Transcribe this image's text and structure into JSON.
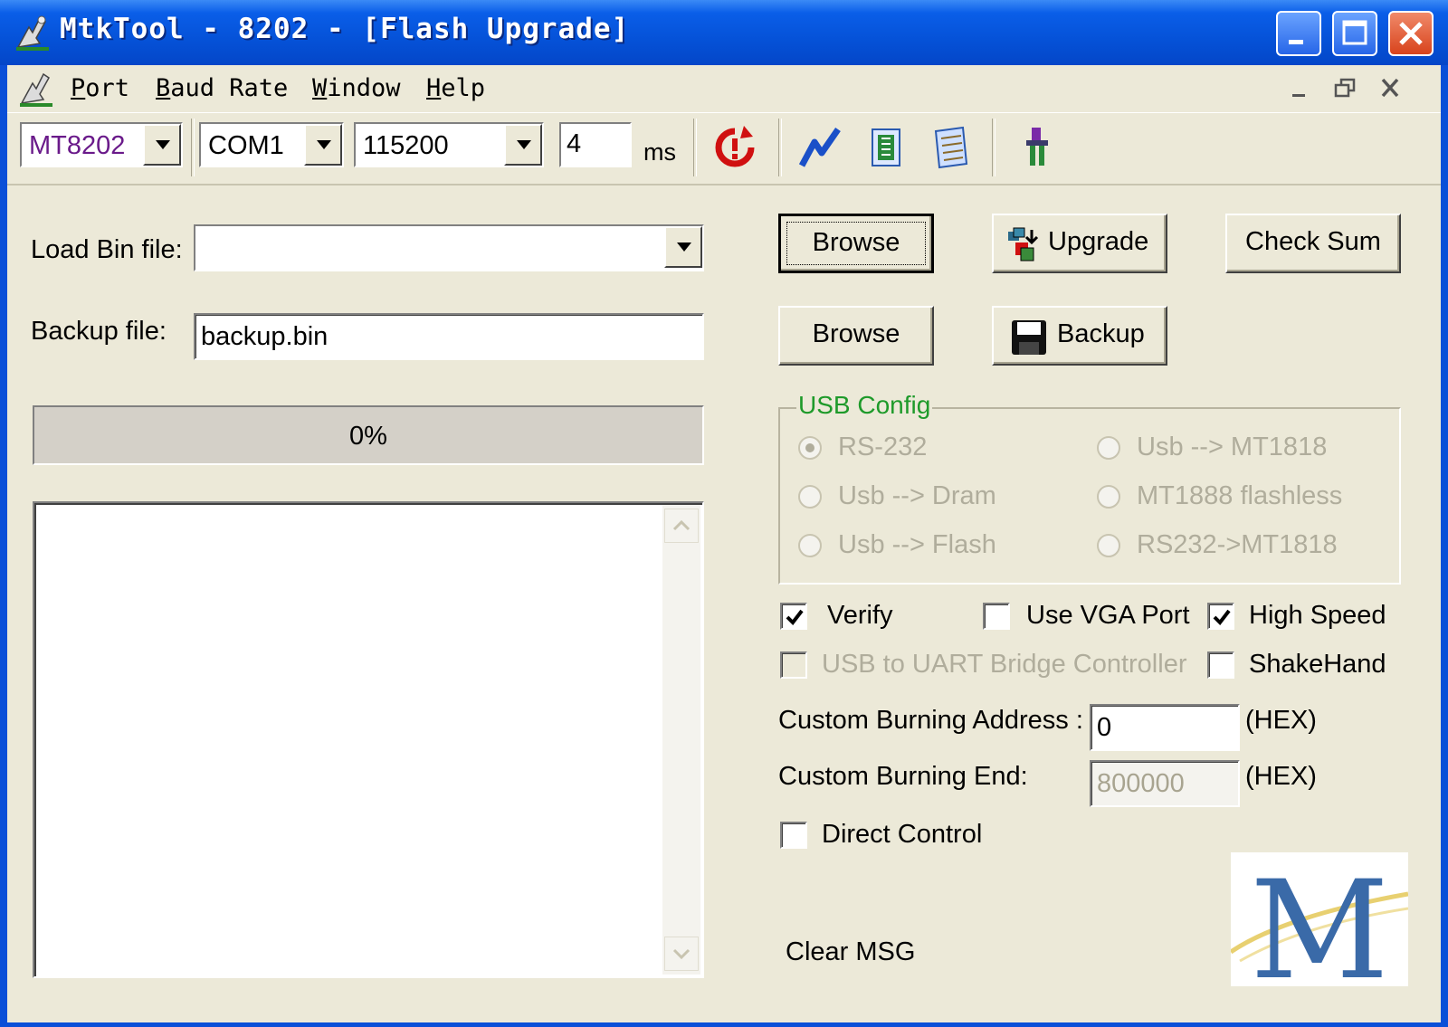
{
  "window": {
    "title": "MtkTool - 8202 - [Flash Upgrade]"
  },
  "menu": {
    "items": [
      {
        "first": "P",
        "rest": "ort"
      },
      {
        "first": "B",
        "rest": "aud Rate"
      },
      {
        "first": "W",
        "rest": "indow"
      },
      {
        "first": "H",
        "rest": "elp"
      }
    ]
  },
  "toolbar": {
    "chip": "MT8202",
    "port": "COM1",
    "baud": "115200",
    "delay": "4",
    "delay_unit": "ms"
  },
  "form": {
    "load_bin_label": "Load Bin file:",
    "load_bin_value": "",
    "backup_label": "Backup file:",
    "backup_value": "backup.bin",
    "browse_label": "Browse",
    "browse2_label": "Browse",
    "upgrade_label": "Upgrade",
    "backup_button_label": "Backup",
    "checksum_label": "Check Sum"
  },
  "progress": {
    "text": "0%",
    "fraction": 0
  },
  "usb_config": {
    "title": "USB Config",
    "options": [
      {
        "label": "RS-232",
        "checked": true
      },
      {
        "label": "Usb --> MT1818",
        "checked": false
      },
      {
        "label": "Usb --> Dram",
        "checked": false
      },
      {
        "label": "MT1888 flashless",
        "checked": false
      },
      {
        "label": "Usb --> Flash",
        "checked": false
      },
      {
        "label": "RS232->MT1818",
        "checked": false
      }
    ]
  },
  "options": {
    "verify": {
      "label": "Verify",
      "checked": true
    },
    "use_vga": {
      "label": "Use VGA Port",
      "checked": false
    },
    "high_speed": {
      "label": "High Speed",
      "checked": true
    },
    "usb_uart": {
      "label": "USB to UART Bridge Controller",
      "checked": false
    },
    "shakehand": {
      "label": "ShakeHand",
      "checked": false
    },
    "direct_control": {
      "label": "Direct Control",
      "checked": false
    }
  },
  "custom": {
    "address_label": "Custom Burning  Address :",
    "address_value": "0",
    "end_label": "Custom Burning  End:",
    "end_value": "800000",
    "hex_unit": "(HEX)"
  },
  "clear_msg": "Clear MSG",
  "logo_letter": "M",
  "colors": {
    "title_bar": "#0a4fd8",
    "face": "#ece9d8",
    "group_title": "#1e9a2a",
    "chip_text": "#6a1a8a",
    "disabled_text": "#b0ad9c"
  }
}
